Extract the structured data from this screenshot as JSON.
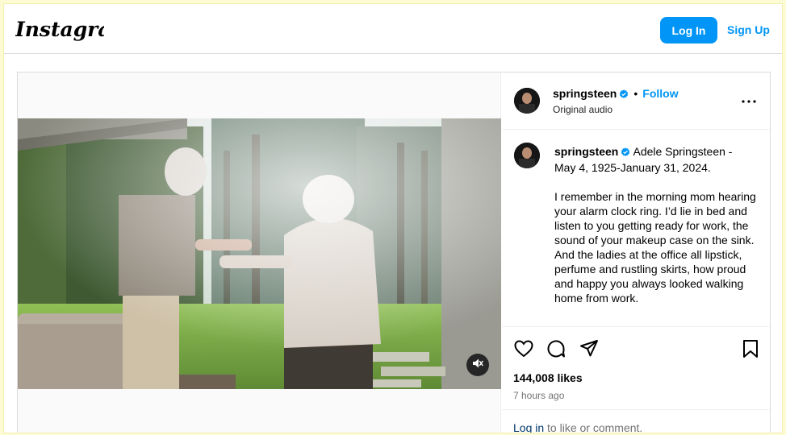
{
  "header": {
    "logo": "Instagram",
    "login_label": "Log In",
    "signup_label": "Sign Up"
  },
  "post": {
    "username": "springsteen",
    "verified": true,
    "follow_label": "Follow",
    "separator": "•",
    "audio_label": "Original audio",
    "caption_lead": "Adele Springsteen - May 4, 1925-January 31, 2024.",
    "caption_body": "I remember in the morning mom hearing your alarm clock ring. I’d lie in bed and listen to you getting ready for work, the sound of your makeup case on the sink. And the ladies at the office all lipstick, perfume and rustling skirts, how proud and happy you always looked walking home from work.",
    "likes": "144,008 likes",
    "timestamp": "7 hours ago",
    "comment_login_link": "Log in",
    "comment_prompt": " to like or comment."
  },
  "icons": {
    "like": "heart-icon",
    "comment": "comment-icon",
    "share": "share-icon",
    "save": "bookmark-icon",
    "mute": "muted-speaker-icon",
    "more": "more-options-icon",
    "verified": "verified-badge-icon"
  },
  "colors": {
    "accent": "#0095f6",
    "link_dark": "#00376b",
    "muted_text": "#737373",
    "border": "#dbdbdb"
  }
}
